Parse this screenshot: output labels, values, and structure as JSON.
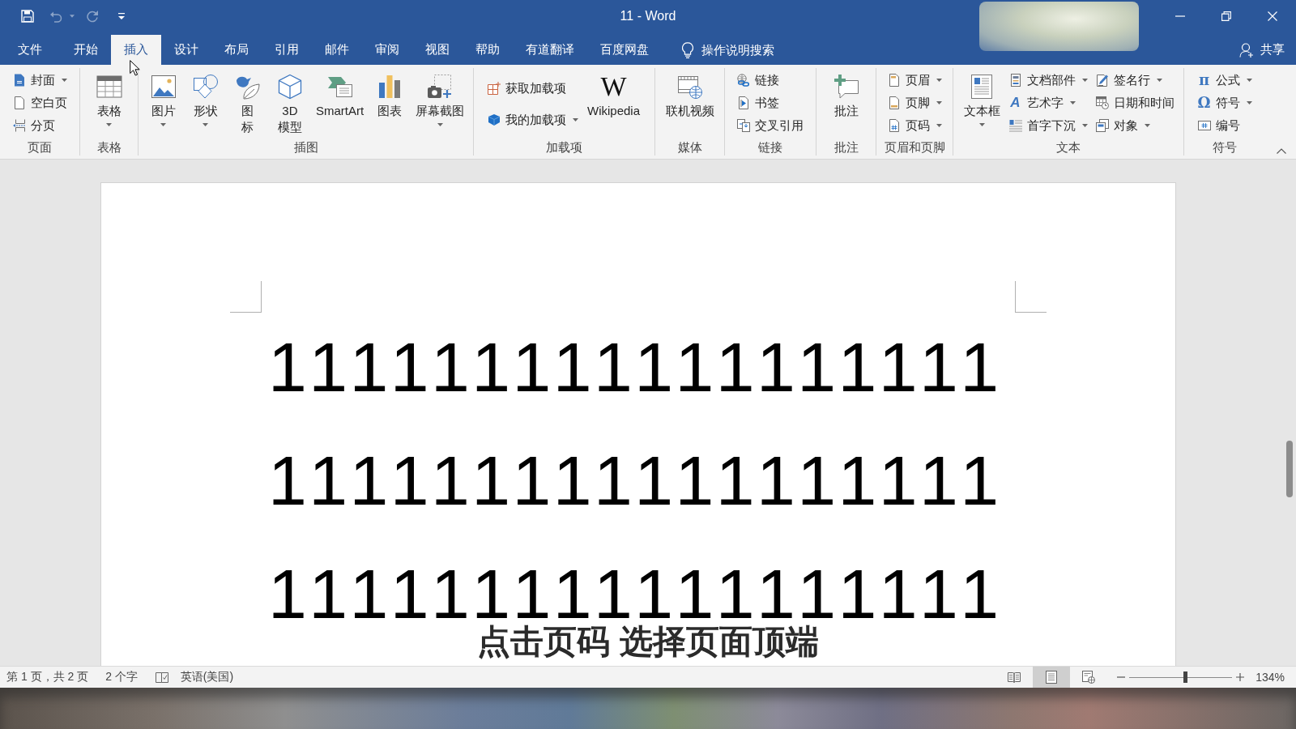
{
  "window": {
    "title": "11 - Word"
  },
  "quick_access": [
    {
      "kind": "save",
      "disabled": false,
      "dropdown": false
    },
    {
      "kind": "undo",
      "disabled": true,
      "dropdown": true
    },
    {
      "kind": "redo",
      "disabled": true,
      "dropdown": false
    },
    {
      "kind": "customize",
      "disabled": false,
      "dropdown": false
    }
  ],
  "window_controls": [
    {
      "kind": "minimize"
    },
    {
      "kind": "restore"
    },
    {
      "kind": "close"
    }
  ],
  "tabs": [
    {
      "label": "文件",
      "selected": false
    },
    {
      "label": "开始",
      "selected": false
    },
    {
      "label": "插入",
      "selected": true
    },
    {
      "label": "设计",
      "selected": false
    },
    {
      "label": "布局",
      "selected": false
    },
    {
      "label": "引用",
      "selected": false
    },
    {
      "label": "邮件",
      "selected": false
    },
    {
      "label": "审阅",
      "selected": false
    },
    {
      "label": "视图",
      "selected": false
    },
    {
      "label": "帮助",
      "selected": false
    },
    {
      "label": "有道翻译",
      "selected": false
    },
    {
      "label": "百度网盘",
      "selected": false
    }
  ],
  "tell_me": {
    "placeholder": "操作说明搜索"
  },
  "share": {
    "label": "共享"
  },
  "ribbon": {
    "groups": [
      {
        "label": "页面",
        "items": [
          {
            "kind": "small",
            "label": "封面",
            "dropdown": true
          },
          {
            "kind": "small",
            "label": "空白页",
            "dropdown": false
          },
          {
            "kind": "small",
            "label": "分页",
            "dropdown": false
          }
        ]
      },
      {
        "label": "表格",
        "items": [
          {
            "kind": "large",
            "label": "表格",
            "dropdown": true
          }
        ]
      },
      {
        "label": "插图",
        "items": [
          {
            "kind": "large",
            "label": "图片",
            "dropdown": true
          },
          {
            "kind": "large",
            "label": "形状",
            "dropdown": true
          },
          {
            "kind": "large",
            "label": "图标",
            "dropdown": false
          },
          {
            "kind": "large",
            "label": "3D 模型",
            "dropdown": false
          },
          {
            "kind": "large",
            "label": "SmartArt",
            "dropdown": false
          },
          {
            "kind": "large",
            "label": "图表",
            "dropdown": false
          },
          {
            "kind": "large",
            "label": "屏幕截图",
            "dropdown": true
          }
        ]
      },
      {
        "label": "加载项",
        "items": [
          {
            "kind": "small",
            "label": "获取加载项",
            "dropdown": false
          },
          {
            "kind": "small",
            "label": "我的加载项",
            "dropdown": true
          },
          {
            "kind": "large",
            "label": "Wikipedia",
            "glyph": "W",
            "dropdown": false
          }
        ]
      },
      {
        "label": "媒体",
        "items": [
          {
            "kind": "large",
            "label": "联机视频",
            "dropdown": false
          }
        ]
      },
      {
        "label": "链接",
        "items": [
          {
            "kind": "small",
            "label": "链接",
            "dropdown": false
          },
          {
            "kind": "small",
            "label": "书签",
            "dropdown": false
          },
          {
            "kind": "small",
            "label": "交叉引用",
            "dropdown": false
          }
        ]
      },
      {
        "label": "批注",
        "items": [
          {
            "kind": "large",
            "label": "批注",
            "dropdown": false
          }
        ]
      },
      {
        "label": "页眉和页脚",
        "items": [
          {
            "kind": "small",
            "label": "页眉",
            "dropdown": true
          },
          {
            "kind": "small",
            "label": "页脚",
            "dropdown": true
          },
          {
            "kind": "small",
            "label": "页码",
            "dropdown": true
          }
        ]
      },
      {
        "label": "文本",
        "items": [
          {
            "kind": "large",
            "label": "文本框",
            "dropdown": true
          },
          {
            "kind": "small",
            "label": "文档部件",
            "dropdown": true
          },
          {
            "kind": "small",
            "label": "艺术字",
            "glyph": "A",
            "dropdown": true
          },
          {
            "kind": "small",
            "label": "首字下沉",
            "dropdown": true
          },
          {
            "kind": "small",
            "label": "签名行",
            "dropdown": true
          },
          {
            "kind": "small",
            "label": "日期和时间",
            "dropdown": false
          },
          {
            "kind": "small",
            "label": "对象",
            "dropdown": true
          }
        ]
      },
      {
        "label": "符号",
        "items": [
          {
            "kind": "small",
            "label": "公式",
            "glyph": "π",
            "dropdown": true
          },
          {
            "kind": "small",
            "label": "符号",
            "glyph": "Ω",
            "dropdown": true
          },
          {
            "kind": "small",
            "label": "编号",
            "dropdown": false
          }
        ]
      }
    ]
  },
  "document": {
    "lines": [
      "111111111111111111",
      "111111111111111111",
      "111111111111111111"
    ]
  },
  "subtitle": "点击页码 选择页面顶端",
  "status_bar": {
    "page": "第 1 页，共 2 页",
    "words": "2 个字",
    "language": "英语(美国)",
    "views": [
      {
        "kind": "read",
        "selected": false
      },
      {
        "kind": "print",
        "selected": true
      },
      {
        "kind": "web",
        "selected": false
      }
    ],
    "zoom": {
      "level": 0.54,
      "reading": "134%"
    }
  }
}
